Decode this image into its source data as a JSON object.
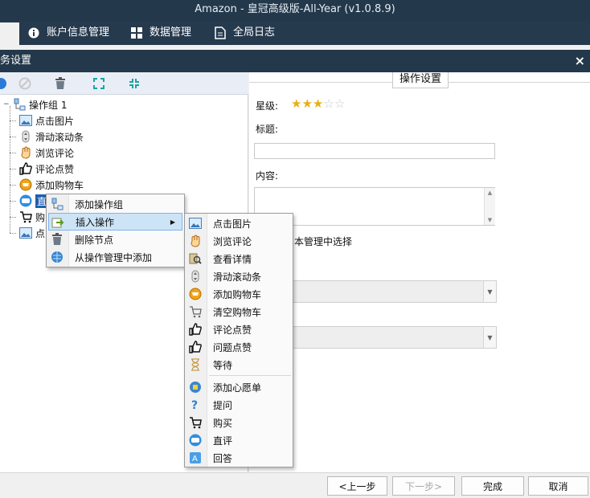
{
  "window": {
    "title": "Amazon - 皇冠高级版-All-Year  (v1.0.8.9)"
  },
  "nav": {
    "items": [
      {
        "label": "账户信息管理",
        "icon": "info-icon"
      },
      {
        "label": "数据管理",
        "icon": "grid-icon"
      },
      {
        "label": "全局日志",
        "icon": "document-icon"
      }
    ]
  },
  "dialog": {
    "title": "务设置",
    "close": "×"
  },
  "tree": {
    "root": "操作组 1",
    "nodes": [
      {
        "label": "点击图片",
        "icon": "image-icon"
      },
      {
        "label": "滑动滚动条",
        "icon": "scroll-icon"
      },
      {
        "label": "浏览评论",
        "icon": "hand-icon"
      },
      {
        "label": "评论点赞",
        "icon": "thumbs-up-icon"
      },
      {
        "label": "添加购物车",
        "icon": "cart-add-icon"
      },
      {
        "label": "直",
        "icon": "chat-icon"
      },
      {
        "label": "购",
        "icon": "cart-icon"
      },
      {
        "label": "点",
        "icon": "image-icon"
      }
    ]
  },
  "context_menu": {
    "items": [
      {
        "label": "添加操作组",
        "icon": "add-group-icon"
      },
      {
        "label": "插入操作",
        "icon": "insert-icon"
      },
      {
        "label": "删除节点",
        "icon": "trash-icon"
      },
      {
        "label": "从操作管理中添加",
        "icon": "globe-icon"
      }
    ],
    "submenu_arrow": "▶"
  },
  "submenu": {
    "items": [
      {
        "label": "点击图片",
        "icon": "image-icon"
      },
      {
        "label": "浏览评论",
        "icon": "hand-icon"
      },
      {
        "label": "查看详情",
        "icon": "detail-icon"
      },
      {
        "label": "滑动滚动条",
        "icon": "scroll-icon"
      },
      {
        "label": "添加购物车",
        "icon": "cart-add-icon"
      },
      {
        "label": "清空购物车",
        "icon": "cart-clear-icon"
      },
      {
        "label": "评论点赞",
        "icon": "thumbs-up-icon"
      },
      {
        "label": "问题点赞",
        "icon": "thumbs-up-icon"
      },
      {
        "label": "等待",
        "icon": "hourglass-icon"
      },
      {
        "label": "添加心愿单",
        "icon": "wishlist-icon"
      },
      {
        "label": "提问",
        "icon": "question-icon"
      },
      {
        "label": "购买",
        "icon": "cart-icon"
      },
      {
        "label": "直评",
        "icon": "chat-icon"
      },
      {
        "label": "回答",
        "icon": "answer-icon"
      }
    ]
  },
  "settings": {
    "group_title": "操作设置",
    "star_label": "星级:",
    "stars_filled": 3,
    "stars_total": 5,
    "title_label": "标题:",
    "title_value": "",
    "content_label": "内容:",
    "content_value": "",
    "checkbox_text": "本管理中选择",
    "select1_value": "",
    "select2_value": ""
  },
  "buttons": {
    "prev": "<上一步",
    "next": "下一步>",
    "finish": "完成",
    "cancel": "取消"
  },
  "colors": {
    "header_bg": "#23384b",
    "selection": "#1f5fb0",
    "star": "#e8b010"
  }
}
